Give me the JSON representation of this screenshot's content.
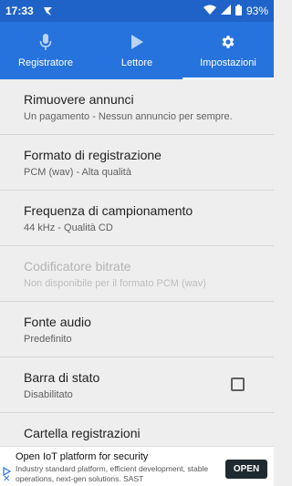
{
  "status_bar": {
    "time": "17:33",
    "battery": "93%"
  },
  "tabs": [
    {
      "label": "Registratore",
      "icon": "microphone-icon",
      "active": false
    },
    {
      "label": "Lettore",
      "icon": "play-icon",
      "active": false
    },
    {
      "label": "Impostazioni",
      "icon": "gear-icon",
      "active": true
    }
  ],
  "settings": [
    {
      "title": "Rimuovere annunci",
      "subtitle": "Un pagamento - Nessun annuncio per sempre."
    },
    {
      "title": "Formato di registrazione",
      "subtitle": "PCM (wav) - Alta qualità"
    },
    {
      "title": "Frequenza di campionamento",
      "subtitle": "44 kHz - Qualità CD"
    },
    {
      "title": "Codificatore bitrate",
      "subtitle": "Non disponibile per il formato PCM (wav)",
      "disabled": true
    },
    {
      "title": "Fonte audio",
      "subtitle": "Predefinito"
    },
    {
      "title": "Barra di stato",
      "subtitle": "Disabilitato",
      "checkbox": false
    },
    {
      "title": "Cartella registrazioni",
      "subtitle": ""
    }
  ],
  "ad": {
    "title": "Open IoT platform for security",
    "text": "Industry standard platform, efficient development, stable operations, next-gen solutions. SAST",
    "button": "OPEN"
  },
  "colors": {
    "status_bar": "#1f63c8",
    "tab_bar": "#2773dd",
    "background": "#eeeeee"
  }
}
